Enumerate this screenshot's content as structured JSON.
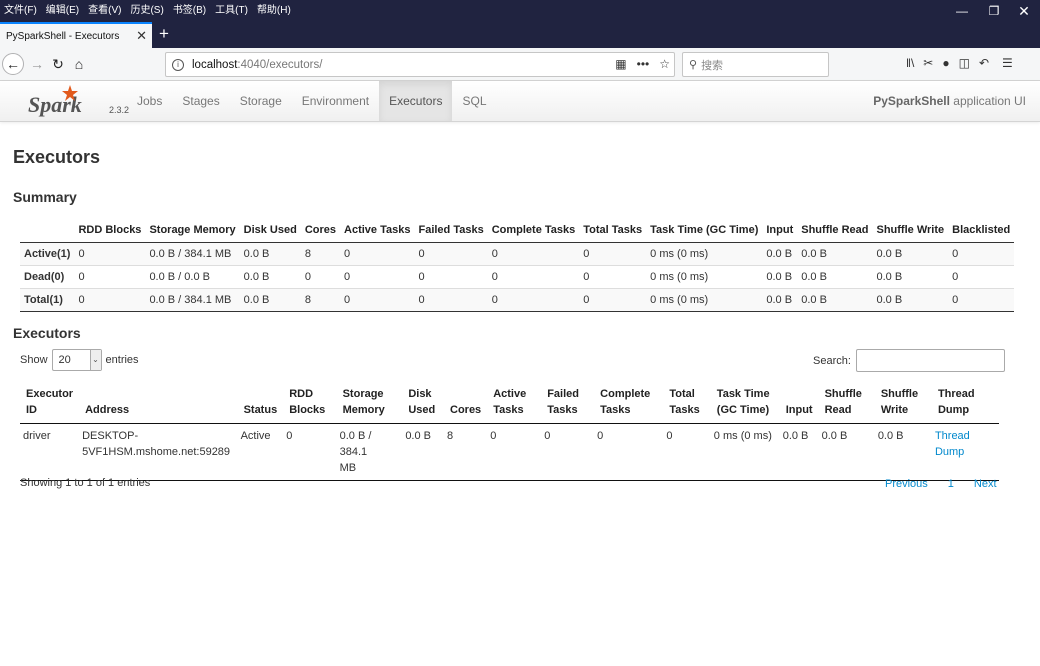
{
  "browser": {
    "menu": [
      "文件(F)",
      "编辑(E)",
      "查看(V)",
      "历史(S)",
      "书签(B)",
      "工具(T)",
      "帮助(H)"
    ],
    "tab_title": "PySparkShell - Executors",
    "url_host": "localhost",
    "url_rest": ":4040/executors/",
    "search_placeholder": "搜索"
  },
  "spark": {
    "version": "2.3.2",
    "nav": [
      "Jobs",
      "Stages",
      "Storage",
      "Environment",
      "Executors",
      "SQL"
    ],
    "active_nav": "Executors",
    "app_name_bold": "PySparkShell",
    "app_name_rest": " application UI"
  },
  "page_title": "Executors",
  "summary": {
    "heading": "Summary",
    "columns": [
      "",
      "RDD Blocks",
      "Storage Memory",
      "Disk Used",
      "Cores",
      "Active Tasks",
      "Failed Tasks",
      "Complete Tasks",
      "Total Tasks",
      "Task Time (GC Time)",
      "Input",
      "Shuffle Read",
      "Shuffle Write",
      "Blacklisted"
    ],
    "rows": [
      [
        "Active(1)",
        "0",
        "0.0 B / 384.1 MB",
        "0.0 B",
        "8",
        "0",
        "0",
        "0",
        "0",
        "0 ms (0 ms)",
        "0.0 B",
        "0.0 B",
        "0.0 B",
        "0"
      ],
      [
        "Dead(0)",
        "0",
        "0.0 B / 0.0 B",
        "0.0 B",
        "0",
        "0",
        "0",
        "0",
        "0",
        "0 ms (0 ms)",
        "0.0 B",
        "0.0 B",
        "0.0 B",
        "0"
      ],
      [
        "Total(1)",
        "0",
        "0.0 B / 384.1 MB",
        "0.0 B",
        "8",
        "0",
        "0",
        "0",
        "0",
        "0 ms (0 ms)",
        "0.0 B",
        "0.0 B",
        "0.0 B",
        "0"
      ]
    ]
  },
  "executors": {
    "heading": "Executors",
    "show_label": "Show",
    "entries_value": "20",
    "entries_label": "entries",
    "search_label": "Search:",
    "columns": [
      [
        "Executor",
        "ID"
      ],
      [
        "",
        "Address"
      ],
      [
        "",
        "Status"
      ],
      [
        "RDD",
        "Blocks"
      ],
      [
        "Storage",
        "Memory"
      ],
      [
        "Disk",
        "Used"
      ],
      [
        "",
        "Cores"
      ],
      [
        "Active",
        "Tasks"
      ],
      [
        "Failed",
        "Tasks"
      ],
      [
        "Complete",
        "Tasks"
      ],
      [
        "Total",
        "Tasks"
      ],
      [
        "Task Time",
        "(GC Time)"
      ],
      [
        "",
        "Input"
      ],
      [
        "Shuffle",
        "Read"
      ],
      [
        "Shuffle",
        "Write"
      ],
      [
        "Thread",
        "Dump"
      ]
    ],
    "rows": [
      {
        "id": "driver",
        "address_1": "DESKTOP-",
        "address_2": "5VF1HSM.mshome.net:59289",
        "status": "Active",
        "rdd_blocks": "0",
        "storage_1": "0.0 B / 384.1",
        "storage_2": "MB",
        "disk_used": "0.0 B",
        "cores": "8",
        "active_tasks": "0",
        "failed_tasks": "0",
        "complete_tasks": "0",
        "total_tasks": "0",
        "task_time": "0 ms (0 ms)",
        "input": "0.0 B",
        "shuffle_read": "0.0 B",
        "shuffle_write": "0.0 B",
        "thread_1": "Thread",
        "thread_2": "Dump"
      }
    ],
    "info": "Showing 1 to 1 of 1 entries",
    "paging": {
      "previous": "Previous",
      "page": "1",
      "next": "Next"
    }
  }
}
